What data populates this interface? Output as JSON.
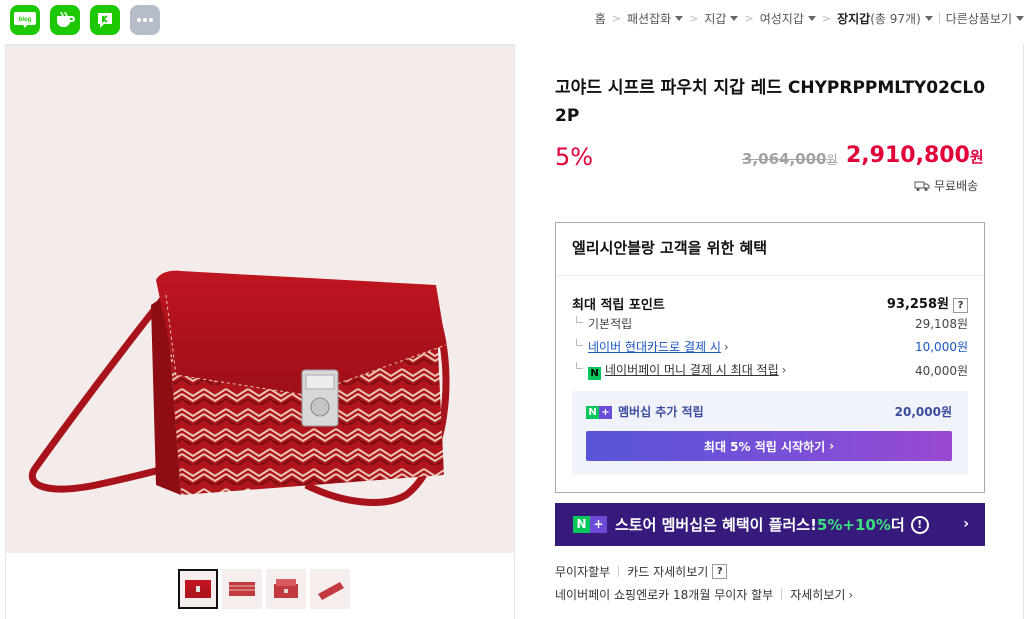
{
  "share": {
    "blog_label": "blog",
    "cafe_icon": "cafe-cup-icon",
    "talk_icon": "talk-icon",
    "more_icon": "more-dots-icon"
  },
  "breadcrumb": {
    "items": [
      "홈",
      "패션잡화",
      "지갑",
      "여성지갑"
    ],
    "current": "장지갑",
    "count": "(총 97개)",
    "other": "다른상품보기"
  },
  "product": {
    "title": "고야드 시프르 파우치 지갑 레드 CHYPRPPMLTY02CL02P",
    "discount": "5%",
    "original_price": "3,064,000",
    "original_unit": "원",
    "sale_price": "2,910,800",
    "sale_unit": "원",
    "shipping": "무료배송"
  },
  "benefit": {
    "heading": "엘리시안블랑 고객을 위한 혜택",
    "max_points_label": "최대 적립 포인트",
    "max_points_value": "93,258원",
    "qmark": "?",
    "basic_label": "기본적립",
    "basic_value": "29,108원",
    "card_label": "네이버 현대카드로 결제 시",
    "card_value": "10,000원",
    "npay_label": "네이버페이 머니 결제 시 최대 적립",
    "npay_value": "40,000원",
    "npay_mark": "N",
    "member_label": "멤버십 추가 적립",
    "member_value": "20,000원",
    "member_cta": "최대 5% 적립 시작하기"
  },
  "banner": {
    "text": "스토어 멤버십은 혜택이 플러스! ",
    "highlight": "5%+10%",
    "suffix": " 더",
    "info": "!"
  },
  "installment": {
    "label": "무이자할부",
    "card_detail": "카드 자세히보기",
    "qmark": "?",
    "naverpay": "네이버페이 쇼핑엔로카 18개월 무이자 할부",
    "detail": "자세히보기"
  },
  "colors": {
    "accent_red": "#e2003c",
    "naver_green": "#03c75a",
    "link_blue": "#1a56c2",
    "banner_bg": "#371b7c"
  }
}
